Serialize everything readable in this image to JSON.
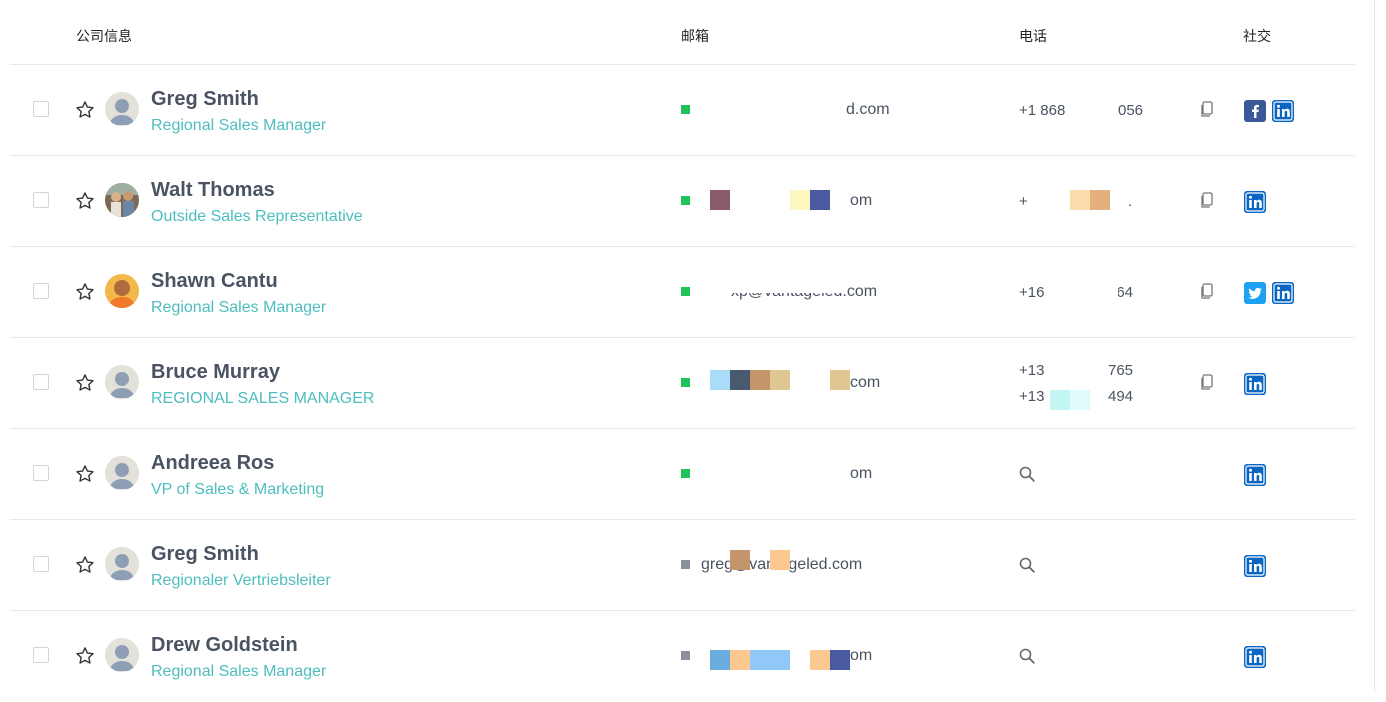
{
  "header": {
    "company": "公司信息",
    "email": "邮箱",
    "phone": "电话",
    "social": "社交"
  },
  "contacts": [
    {
      "name": "Greg Smith",
      "title": "Regional Sales Manager",
      "email": "d.com",
      "email_status": "valid",
      "phones": [
        "+1 868",
        "056"
      ],
      "has_copy": true,
      "socials": [
        "facebook-icon",
        "linkedin-icon"
      ]
    },
    {
      "name": "Walt Thomas",
      "title": "Outside Sales Representative",
      "email": "om",
      "email_status": "valid",
      "phones": [
        "+",
        "."
      ],
      "has_copy": true,
      "socials": [
        "linkedin-icon"
      ]
    },
    {
      "name": "Shawn Cantu",
      "title": "Regional Sales Manager",
      "email": "xp@vantageled.com",
      "email_status": "valid",
      "phones": [
        "+16",
        "564"
      ],
      "has_copy": true,
      "socials": [
        "twitter-icon",
        "linkedin-icon"
      ]
    },
    {
      "name": "Bruce Murray",
      "title": "REGIONAL SALES MANAGER",
      "email": "com",
      "email_status": "valid",
      "phones": [
        "+13",
        "765",
        "+13",
        "494"
      ],
      "has_copy": true,
      "socials": [
        "linkedin-icon"
      ]
    },
    {
      "name": "Andreea Ros",
      "title": "VP of Sales & Marketing",
      "email": "om",
      "email_status": "valid",
      "phones": [],
      "has_copy": false,
      "socials": [
        "linkedin-icon"
      ]
    },
    {
      "name": "Greg Smith",
      "title": "Regionaler Vertriebsleiter",
      "email": "greg@vantageled.com",
      "email_status": "unverified",
      "phones": [],
      "has_copy": false,
      "socials": [
        "linkedin-icon"
      ]
    },
    {
      "name": "Drew Goldstein",
      "title": "Regional Sales Manager",
      "email": "om",
      "email_status": "unverified",
      "phones": [],
      "has_copy": false,
      "socials": [
        "linkedin-icon"
      ]
    }
  ],
  "colors": {
    "name": "#4a5361",
    "title": "#4dbdbf",
    "valid": "#1fc35a",
    "unverified": "#8a9099",
    "linkedin": "#0a66c2",
    "facebook": "#3b5998",
    "twitter": "#1da1f2"
  }
}
